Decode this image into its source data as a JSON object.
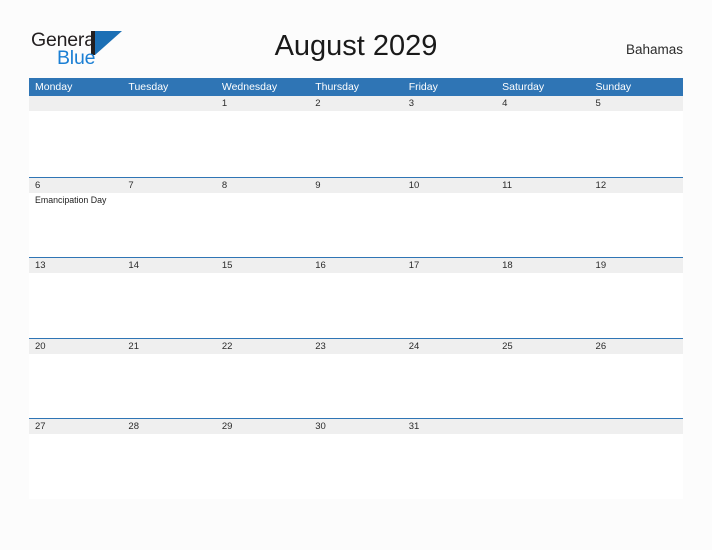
{
  "brand": {
    "name_part1": "General",
    "name_part2": "Blue",
    "logo_icon": "general-blue-triangle-logo",
    "accent_color": "#1b7fd4"
  },
  "header": {
    "title": "August 2029",
    "region": "Bahamas"
  },
  "theme": {
    "header_blue": "#2f75b5",
    "row_divider_blue": "#2f75b5",
    "day_band_gray": "#efefef",
    "page_background": "#fcfcfc",
    "text_color": "#222222"
  },
  "calendar": {
    "month": "August",
    "year": "2029",
    "weekday_headers": [
      "Monday",
      "Tuesday",
      "Wednesday",
      "Thursday",
      "Friday",
      "Saturday",
      "Sunday"
    ],
    "weeks": [
      {
        "days": [
          {
            "date": "",
            "events": []
          },
          {
            "date": "",
            "events": []
          },
          {
            "date": "1",
            "events": []
          },
          {
            "date": "2",
            "events": []
          },
          {
            "date": "3",
            "events": []
          },
          {
            "date": "4",
            "events": []
          },
          {
            "date": "5",
            "events": []
          }
        ]
      },
      {
        "days": [
          {
            "date": "6",
            "events": [
              "Emancipation Day"
            ]
          },
          {
            "date": "7",
            "events": []
          },
          {
            "date": "8",
            "events": []
          },
          {
            "date": "9",
            "events": []
          },
          {
            "date": "10",
            "events": []
          },
          {
            "date": "11",
            "events": []
          },
          {
            "date": "12",
            "events": []
          }
        ]
      },
      {
        "days": [
          {
            "date": "13",
            "events": []
          },
          {
            "date": "14",
            "events": []
          },
          {
            "date": "15",
            "events": []
          },
          {
            "date": "16",
            "events": []
          },
          {
            "date": "17",
            "events": []
          },
          {
            "date": "18",
            "events": []
          },
          {
            "date": "19",
            "events": []
          }
        ]
      },
      {
        "days": [
          {
            "date": "20",
            "events": []
          },
          {
            "date": "21",
            "events": []
          },
          {
            "date": "22",
            "events": []
          },
          {
            "date": "23",
            "events": []
          },
          {
            "date": "24",
            "events": []
          },
          {
            "date": "25",
            "events": []
          },
          {
            "date": "26",
            "events": []
          }
        ]
      },
      {
        "days": [
          {
            "date": "27",
            "events": []
          },
          {
            "date": "28",
            "events": []
          },
          {
            "date": "29",
            "events": []
          },
          {
            "date": "30",
            "events": []
          },
          {
            "date": "31",
            "events": []
          },
          {
            "date": "",
            "events": []
          },
          {
            "date": "",
            "events": []
          }
        ]
      }
    ]
  }
}
